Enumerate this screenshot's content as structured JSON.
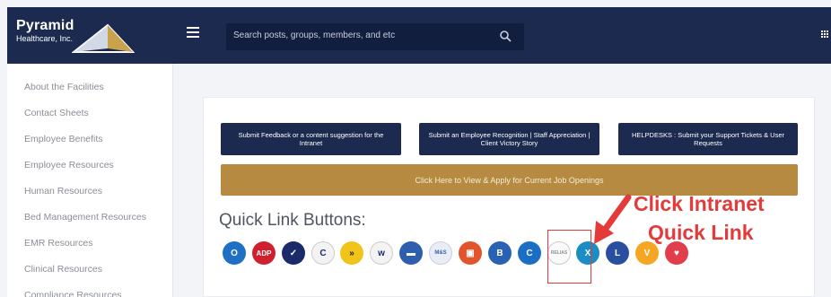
{
  "header": {
    "logo_name": "Pyramid",
    "logo_sub": "Healthcare, Inc.",
    "search_placeholder": "Search posts, groups, members, and etc"
  },
  "sidebar": {
    "items": [
      {
        "label": "About the Facilities"
      },
      {
        "label": "Contact Sheets"
      },
      {
        "label": "Employee Benefits"
      },
      {
        "label": "Employee Resources"
      },
      {
        "label": "Human Resources"
      },
      {
        "label": "Bed Management Resources"
      },
      {
        "label": "EMR Resources"
      },
      {
        "label": "Clinical Resources"
      },
      {
        "label": "Compliance Resources"
      }
    ]
  },
  "main": {
    "buttons": [
      {
        "label": "Submit Feedback or a content suggestion for the Intranet"
      },
      {
        "label": "Submit an Employee Recognition | Staff Appreciation | Client Victory Story"
      },
      {
        "label": "HELPDESKS : Submit your Support Tickets & User Requests"
      }
    ],
    "jobs_button": "Click Here to View & Apply for Current Job Openings",
    "quick_links_title": "Quick Link Buttons:",
    "quick_links": [
      {
        "icon": "outlook-icon",
        "glyph": "O",
        "color": "#1f6fc5"
      },
      {
        "icon": "adp-icon",
        "glyph": "ADP",
        "color": "#d0202e"
      },
      {
        "icon": "checkbox-icon",
        "glyph": "✓",
        "color": "#1b2a6b"
      },
      {
        "icon": "c-app-icon",
        "glyph": "C",
        "color": "#f3f3f3"
      },
      {
        "icon": "arrow-app-icon",
        "glyph": "»",
        "color": "#f0c419"
      },
      {
        "icon": "wave-app-icon",
        "glyph": "w",
        "color": "#f3f3f3"
      },
      {
        "icon": "bed-icon",
        "glyph": "▬",
        "color": "#2d5fae"
      },
      {
        "icon": "mes-eap-icon",
        "glyph": "M&S",
        "color": "#e9eef6"
      },
      {
        "icon": "square-app-icon",
        "glyph": "▣",
        "color": "#e2542c"
      },
      {
        "icon": "bi-icon",
        "glyph": "B",
        "color": "#2a62b3"
      },
      {
        "icon": "c-blue-icon",
        "glyph": "C",
        "color": "#1a6fc4"
      },
      {
        "icon": "relias-icon",
        "glyph": "RELIAS",
        "color": "#fafafa"
      },
      {
        "icon": "x-app-icon",
        "glyph": "X",
        "color": "#1c8cc4"
      },
      {
        "icon": "intranet-icon",
        "glyph": "L",
        "color": "#2a4fa0"
      },
      {
        "icon": "v-app-icon",
        "glyph": "V",
        "color": "#f5a623"
      },
      {
        "icon": "heart-icon",
        "glyph": "♥",
        "color": "#e13d4a"
      }
    ]
  },
  "annotation": {
    "line1": "Click Intranet",
    "line2": "Quick Link",
    "color": "#e43a3a"
  }
}
